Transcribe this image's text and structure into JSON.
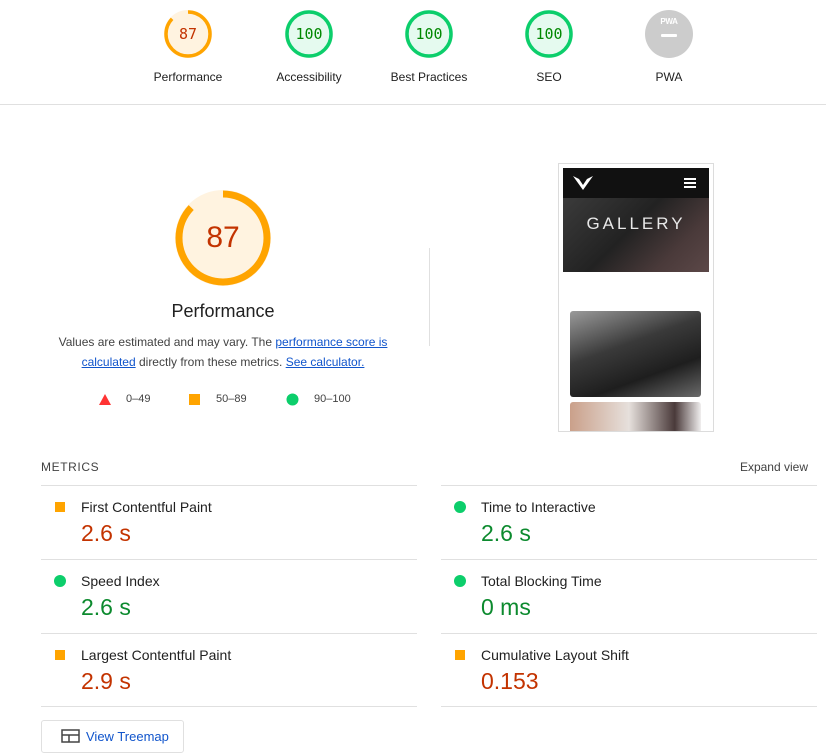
{
  "summary": {
    "categories": [
      {
        "label": "Performance",
        "score": "87",
        "value": 87,
        "color": "#ffa400",
        "fill": "#fff3e0",
        "text_color": "#c33300"
      },
      {
        "label": "Accessibility",
        "score": "100",
        "value": 100,
        "color": "#0cce6b",
        "fill": "#e5faef",
        "text_color": "#008800"
      },
      {
        "label": "Best Practices",
        "score": "100",
        "value": 100,
        "color": "#0cce6b",
        "fill": "#e5faef",
        "text_color": "#008800"
      },
      {
        "label": "SEO",
        "score": "100",
        "value": 100,
        "color": "#0cce6b",
        "fill": "#e5faef",
        "text_color": "#008800"
      },
      {
        "label": "PWA",
        "badge": "PWA",
        "color": "#cccccc"
      }
    ]
  },
  "performance": {
    "score": "87",
    "value": 87,
    "title": "Performance",
    "explain_prefix": "Values are estimated and may vary. The ",
    "explain_link1": "performance score is calculated",
    "explain_mid": " directly from these metrics. ",
    "explain_link2": "See calculator."
  },
  "legend": [
    {
      "range": "0–49",
      "shape": "triangle-icon",
      "color": "#ff3333"
    },
    {
      "range": "50–89",
      "shape": "square-icon",
      "color": "#ffa400"
    },
    {
      "range": "90–100",
      "shape": "circle-icon",
      "color": "#0cce6b"
    }
  ],
  "screenshot": {
    "gallery_text": "GALLERY"
  },
  "metrics": {
    "heading": "METRICS",
    "expand_label": "Expand view",
    "items": [
      {
        "name": "First Contentful Paint",
        "value": "2.6 s",
        "rating": "average"
      },
      {
        "name": "Time to Interactive",
        "value": "2.6 s",
        "rating": "pass"
      },
      {
        "name": "Speed Index",
        "value": "2.6 s",
        "rating": "pass"
      },
      {
        "name": "Total Blocking Time",
        "value": "0 ms",
        "rating": "pass"
      },
      {
        "name": "Largest Contentful Paint",
        "value": "2.9 s",
        "rating": "average"
      },
      {
        "name": "Cumulative Layout Shift",
        "value": "0.153",
        "rating": "average"
      }
    ]
  },
  "treemap": {
    "label": "View Treemap"
  }
}
